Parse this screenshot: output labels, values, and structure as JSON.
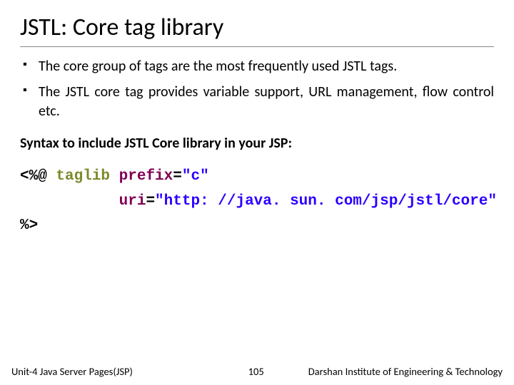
{
  "title": "JSTL: Core tag library",
  "bullets": [
    "The core group of tags are the most frequently used JSTL tags.",
    "The JSTL core tag provides variable support, URL management, flow control etc."
  ],
  "syntax_label": "Syntax to include JSTL Core library in your JSP:",
  "code": {
    "open_delim": "<%@",
    "directive": " taglib ",
    "attr_prefix": "prefix",
    "eq1": "=",
    "val_prefix": "\"c\"",
    "indent": "           ",
    "attr_uri": "uri",
    "eq2": "=",
    "val_uri": "\"http: //java. sun. com/jsp/jstl/core\"",
    "close_delim": "%>"
  },
  "footer": {
    "left": "Unit-4 Java Server Pages(JSP)",
    "center": "105",
    "right": "Darshan Institute of Engineering & Technology"
  }
}
